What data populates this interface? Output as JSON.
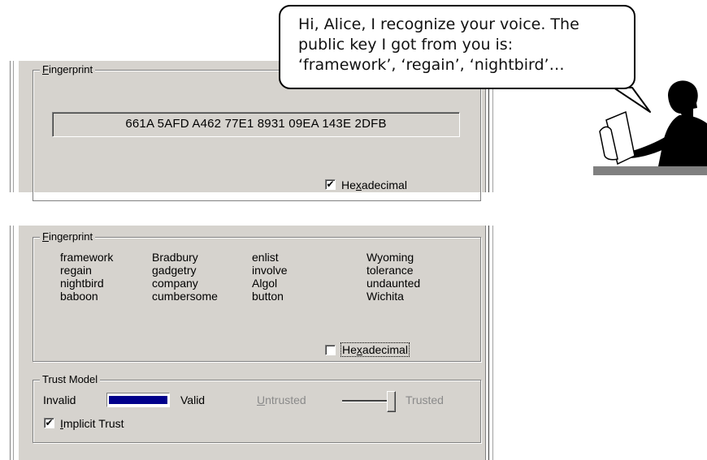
{
  "speech_bubble": {
    "lines": [
      "Hi, Alice, I recognize your voice. The",
      "public key I got from you is:",
      "‘framework’, ‘regain’, ‘nightbird’…"
    ]
  },
  "top_dialog": {
    "fingerprint_group": {
      "legend_first": "F",
      "legend_rest": "ingerprint",
      "hex_value": "661A 5AFD A462 77E1  8931 09EA 143E 2DFB"
    },
    "hexadecimal_checkbox": {
      "label_pre": "He",
      "label_ul": "x",
      "label_post": "adecimal",
      "checked": true,
      "mark": "✔"
    }
  },
  "bottom_dialog": {
    "fingerprint_group": {
      "legend_first": "F",
      "legend_rest": "ingerprint",
      "words": {
        "col1": [
          "framework",
          "regain",
          "nightbird",
          "baboon"
        ],
        "col2": [
          "Bradbury",
          "gadgetry",
          "company",
          "cumbersome"
        ],
        "col3": [
          "enlist",
          "involve",
          "Algol",
          "button"
        ],
        "col4": [
          "Wyoming",
          "tolerance",
          "undaunted",
          "Wichita"
        ]
      }
    },
    "hexadecimal_checkbox": {
      "label_pre": "He",
      "label_ul": "x",
      "label_post": "adecimal",
      "checked": false
    },
    "trust_model_group": {
      "legend": "Trust Model",
      "invalid_label": "Invalid",
      "valid_label": "Valid",
      "validity_bar_color": "#00008b",
      "untrusted_first": "U",
      "untrusted_rest": "ntrusted",
      "trusted_label": "Trusted",
      "trust_slider_value_percent": 95,
      "implicit_trust": {
        "label_first": "I",
        "label_rest": "mplicit Trust",
        "checked": true,
        "mark": "✔"
      }
    }
  }
}
